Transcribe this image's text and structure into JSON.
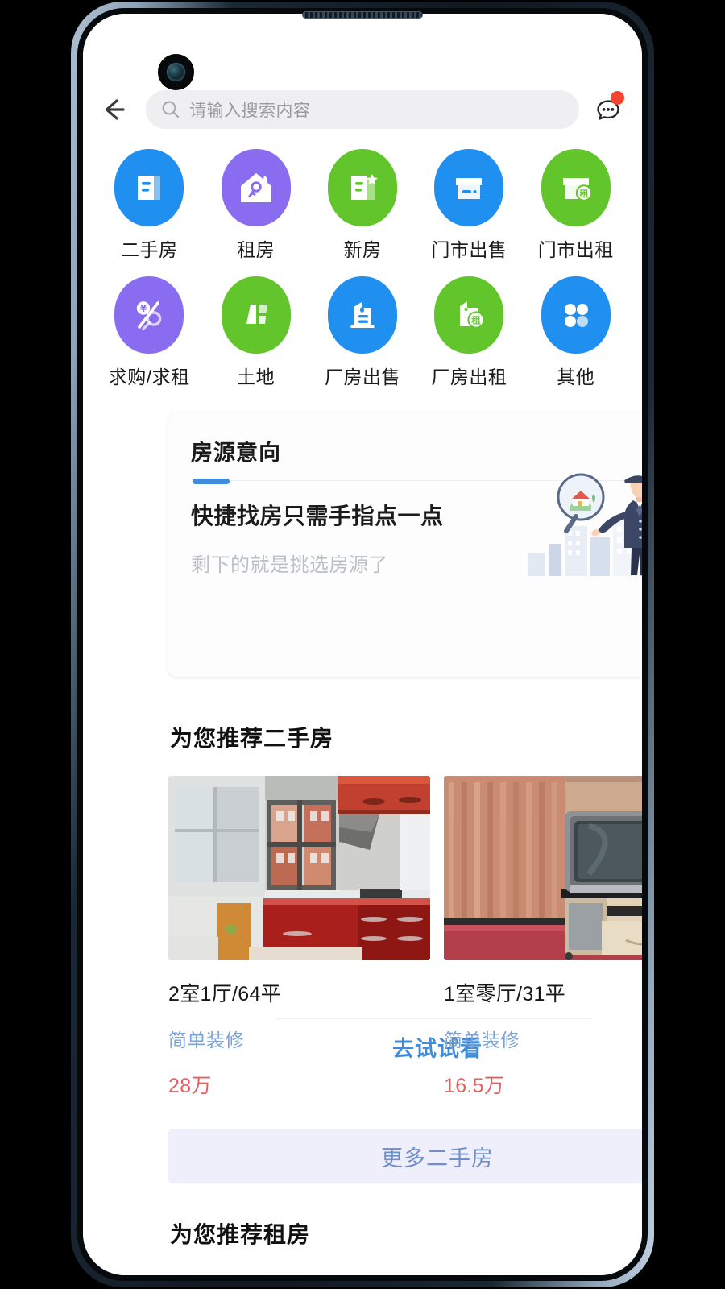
{
  "topbar": {
    "back_icon": "back-arrow-icon",
    "search_placeholder": "请输入搜索内容",
    "search_icon": "search-icon",
    "chat_icon": "chat-bubble-icon",
    "chat_has_badge": true
  },
  "icon_grid": {
    "items": [
      {
        "label": "二手房",
        "icon": "document-house-icon",
        "color": "#1f8ff0"
      },
      {
        "label": "租房",
        "icon": "house-key-icon",
        "color": "#8a6cf0"
      },
      {
        "label": "新房",
        "icon": "new-document-star-icon",
        "color": "#62c52c"
      },
      {
        "label": "门市出售",
        "icon": "shop-sale-icon",
        "color": "#1f8ff0"
      },
      {
        "label": "门市出租",
        "icon": "shop-rent-icon",
        "color": "#62c52c"
      },
      {
        "label": "求购/求租",
        "icon": "yuan-percent-key-icon",
        "color": "#8a6cf0"
      },
      {
        "label": "土地",
        "icon": "land-plots-icon",
        "color": "#62c52c"
      },
      {
        "label": "厂房出售",
        "icon": "factory-sale-icon",
        "color": "#1f8ff0"
      },
      {
        "label": "厂房出租",
        "icon": "factory-rent-icon",
        "color": "#62c52c"
      },
      {
        "label": "其他",
        "icon": "four-dots-icon",
        "color": "#1f8ff0"
      }
    ]
  },
  "intent_card": {
    "tab_label": "房源意向",
    "headline": "快捷找房只需手指点一点",
    "subtext": "剩下的就是挑选房源了",
    "cta_label": "去试试看",
    "illustration": "businessman-magnifier-city-icon",
    "accent_color": "#3f8bdc"
  },
  "secondhand_section": {
    "title": "为您推荐二手房",
    "listings": [
      {
        "photo": "kitchen-red-cabinets-photo",
        "title": "2室1厅/64平",
        "tag": "简单装修",
        "price": "28万"
      },
      {
        "photo": "living-room-crt-tv-photo",
        "title": "1室零厅/31平",
        "tag": "简单装修",
        "price": "16.5万"
      }
    ],
    "more_label": "更多二手房"
  },
  "rental_section": {
    "title": "为您推荐租房"
  },
  "colors": {
    "blue": "#1f8ff0",
    "green": "#62c52c",
    "purple": "#8a6cf0",
    "price_red": "#e2625f",
    "tag_blue": "#7ba3d6",
    "badge_red": "#f4452f"
  }
}
